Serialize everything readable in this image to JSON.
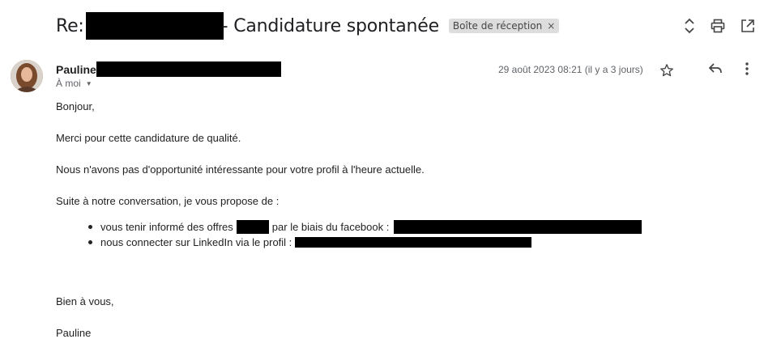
{
  "email": {
    "subject_prefix": "Re:",
    "subject_suffix": "- Candidature spontanée",
    "label": "Boîte de réception",
    "label_remove": "×",
    "sender_first_name": "Pauline",
    "recipient": "À moi",
    "date": "29 août 2023 08:21 (il y a 3 jours)",
    "body": {
      "greeting": "Bonjour,",
      "line1": "Merci pour cette candidature de qualité.",
      "line2": "Nous n'avons pas d'opportunité intéressante pour votre profil à l'heure actuelle.",
      "line3": "Suite à notre conversation, je vous propose de :",
      "bullet1_a": "vous tenir informé des offres",
      "bullet1_b": "par le biais du facebook :",
      "bullet2_a": "nous connecter sur LinkedIn via le profil :",
      "closing": "Bien à vous,",
      "signature": "Pauline"
    }
  },
  "icons": {
    "expand": "unfold-icon",
    "print": "print-icon",
    "open_new": "open-in-new-icon",
    "star": "star-icon",
    "reply": "reply-icon",
    "more": "more-vert-icon"
  }
}
